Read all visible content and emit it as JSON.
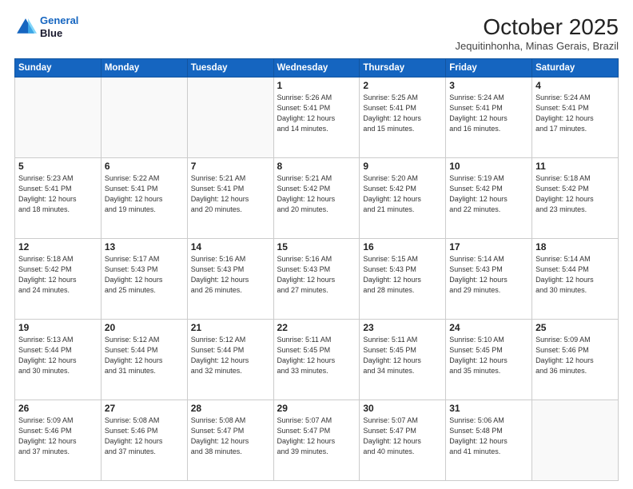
{
  "header": {
    "logo_line1": "General",
    "logo_line2": "Blue",
    "month": "October 2025",
    "location": "Jequitinhonha, Minas Gerais, Brazil"
  },
  "weekdays": [
    "Sunday",
    "Monday",
    "Tuesday",
    "Wednesday",
    "Thursday",
    "Friday",
    "Saturday"
  ],
  "weeks": [
    [
      {
        "day": "",
        "info": ""
      },
      {
        "day": "",
        "info": ""
      },
      {
        "day": "",
        "info": ""
      },
      {
        "day": "1",
        "info": "Sunrise: 5:26 AM\nSunset: 5:41 PM\nDaylight: 12 hours\nand 14 minutes."
      },
      {
        "day": "2",
        "info": "Sunrise: 5:25 AM\nSunset: 5:41 PM\nDaylight: 12 hours\nand 15 minutes."
      },
      {
        "day": "3",
        "info": "Sunrise: 5:24 AM\nSunset: 5:41 PM\nDaylight: 12 hours\nand 16 minutes."
      },
      {
        "day": "4",
        "info": "Sunrise: 5:24 AM\nSunset: 5:41 PM\nDaylight: 12 hours\nand 17 minutes."
      }
    ],
    [
      {
        "day": "5",
        "info": "Sunrise: 5:23 AM\nSunset: 5:41 PM\nDaylight: 12 hours\nand 18 minutes."
      },
      {
        "day": "6",
        "info": "Sunrise: 5:22 AM\nSunset: 5:41 PM\nDaylight: 12 hours\nand 19 minutes."
      },
      {
        "day": "7",
        "info": "Sunrise: 5:21 AM\nSunset: 5:41 PM\nDaylight: 12 hours\nand 20 minutes."
      },
      {
        "day": "8",
        "info": "Sunrise: 5:21 AM\nSunset: 5:42 PM\nDaylight: 12 hours\nand 20 minutes."
      },
      {
        "day": "9",
        "info": "Sunrise: 5:20 AM\nSunset: 5:42 PM\nDaylight: 12 hours\nand 21 minutes."
      },
      {
        "day": "10",
        "info": "Sunrise: 5:19 AM\nSunset: 5:42 PM\nDaylight: 12 hours\nand 22 minutes."
      },
      {
        "day": "11",
        "info": "Sunrise: 5:18 AM\nSunset: 5:42 PM\nDaylight: 12 hours\nand 23 minutes."
      }
    ],
    [
      {
        "day": "12",
        "info": "Sunrise: 5:18 AM\nSunset: 5:42 PM\nDaylight: 12 hours\nand 24 minutes."
      },
      {
        "day": "13",
        "info": "Sunrise: 5:17 AM\nSunset: 5:43 PM\nDaylight: 12 hours\nand 25 minutes."
      },
      {
        "day": "14",
        "info": "Sunrise: 5:16 AM\nSunset: 5:43 PM\nDaylight: 12 hours\nand 26 minutes."
      },
      {
        "day": "15",
        "info": "Sunrise: 5:16 AM\nSunset: 5:43 PM\nDaylight: 12 hours\nand 27 minutes."
      },
      {
        "day": "16",
        "info": "Sunrise: 5:15 AM\nSunset: 5:43 PM\nDaylight: 12 hours\nand 28 minutes."
      },
      {
        "day": "17",
        "info": "Sunrise: 5:14 AM\nSunset: 5:43 PM\nDaylight: 12 hours\nand 29 minutes."
      },
      {
        "day": "18",
        "info": "Sunrise: 5:14 AM\nSunset: 5:44 PM\nDaylight: 12 hours\nand 30 minutes."
      }
    ],
    [
      {
        "day": "19",
        "info": "Sunrise: 5:13 AM\nSunset: 5:44 PM\nDaylight: 12 hours\nand 30 minutes."
      },
      {
        "day": "20",
        "info": "Sunrise: 5:12 AM\nSunset: 5:44 PM\nDaylight: 12 hours\nand 31 minutes."
      },
      {
        "day": "21",
        "info": "Sunrise: 5:12 AM\nSunset: 5:44 PM\nDaylight: 12 hours\nand 32 minutes."
      },
      {
        "day": "22",
        "info": "Sunrise: 5:11 AM\nSunset: 5:45 PM\nDaylight: 12 hours\nand 33 minutes."
      },
      {
        "day": "23",
        "info": "Sunrise: 5:11 AM\nSunset: 5:45 PM\nDaylight: 12 hours\nand 34 minutes."
      },
      {
        "day": "24",
        "info": "Sunrise: 5:10 AM\nSunset: 5:45 PM\nDaylight: 12 hours\nand 35 minutes."
      },
      {
        "day": "25",
        "info": "Sunrise: 5:09 AM\nSunset: 5:46 PM\nDaylight: 12 hours\nand 36 minutes."
      }
    ],
    [
      {
        "day": "26",
        "info": "Sunrise: 5:09 AM\nSunset: 5:46 PM\nDaylight: 12 hours\nand 37 minutes."
      },
      {
        "day": "27",
        "info": "Sunrise: 5:08 AM\nSunset: 5:46 PM\nDaylight: 12 hours\nand 37 minutes."
      },
      {
        "day": "28",
        "info": "Sunrise: 5:08 AM\nSunset: 5:47 PM\nDaylight: 12 hours\nand 38 minutes."
      },
      {
        "day": "29",
        "info": "Sunrise: 5:07 AM\nSunset: 5:47 PM\nDaylight: 12 hours\nand 39 minutes."
      },
      {
        "day": "30",
        "info": "Sunrise: 5:07 AM\nSunset: 5:47 PM\nDaylight: 12 hours\nand 40 minutes."
      },
      {
        "day": "31",
        "info": "Sunrise: 5:06 AM\nSunset: 5:48 PM\nDaylight: 12 hours\nand 41 minutes."
      },
      {
        "day": "",
        "info": ""
      }
    ]
  ]
}
